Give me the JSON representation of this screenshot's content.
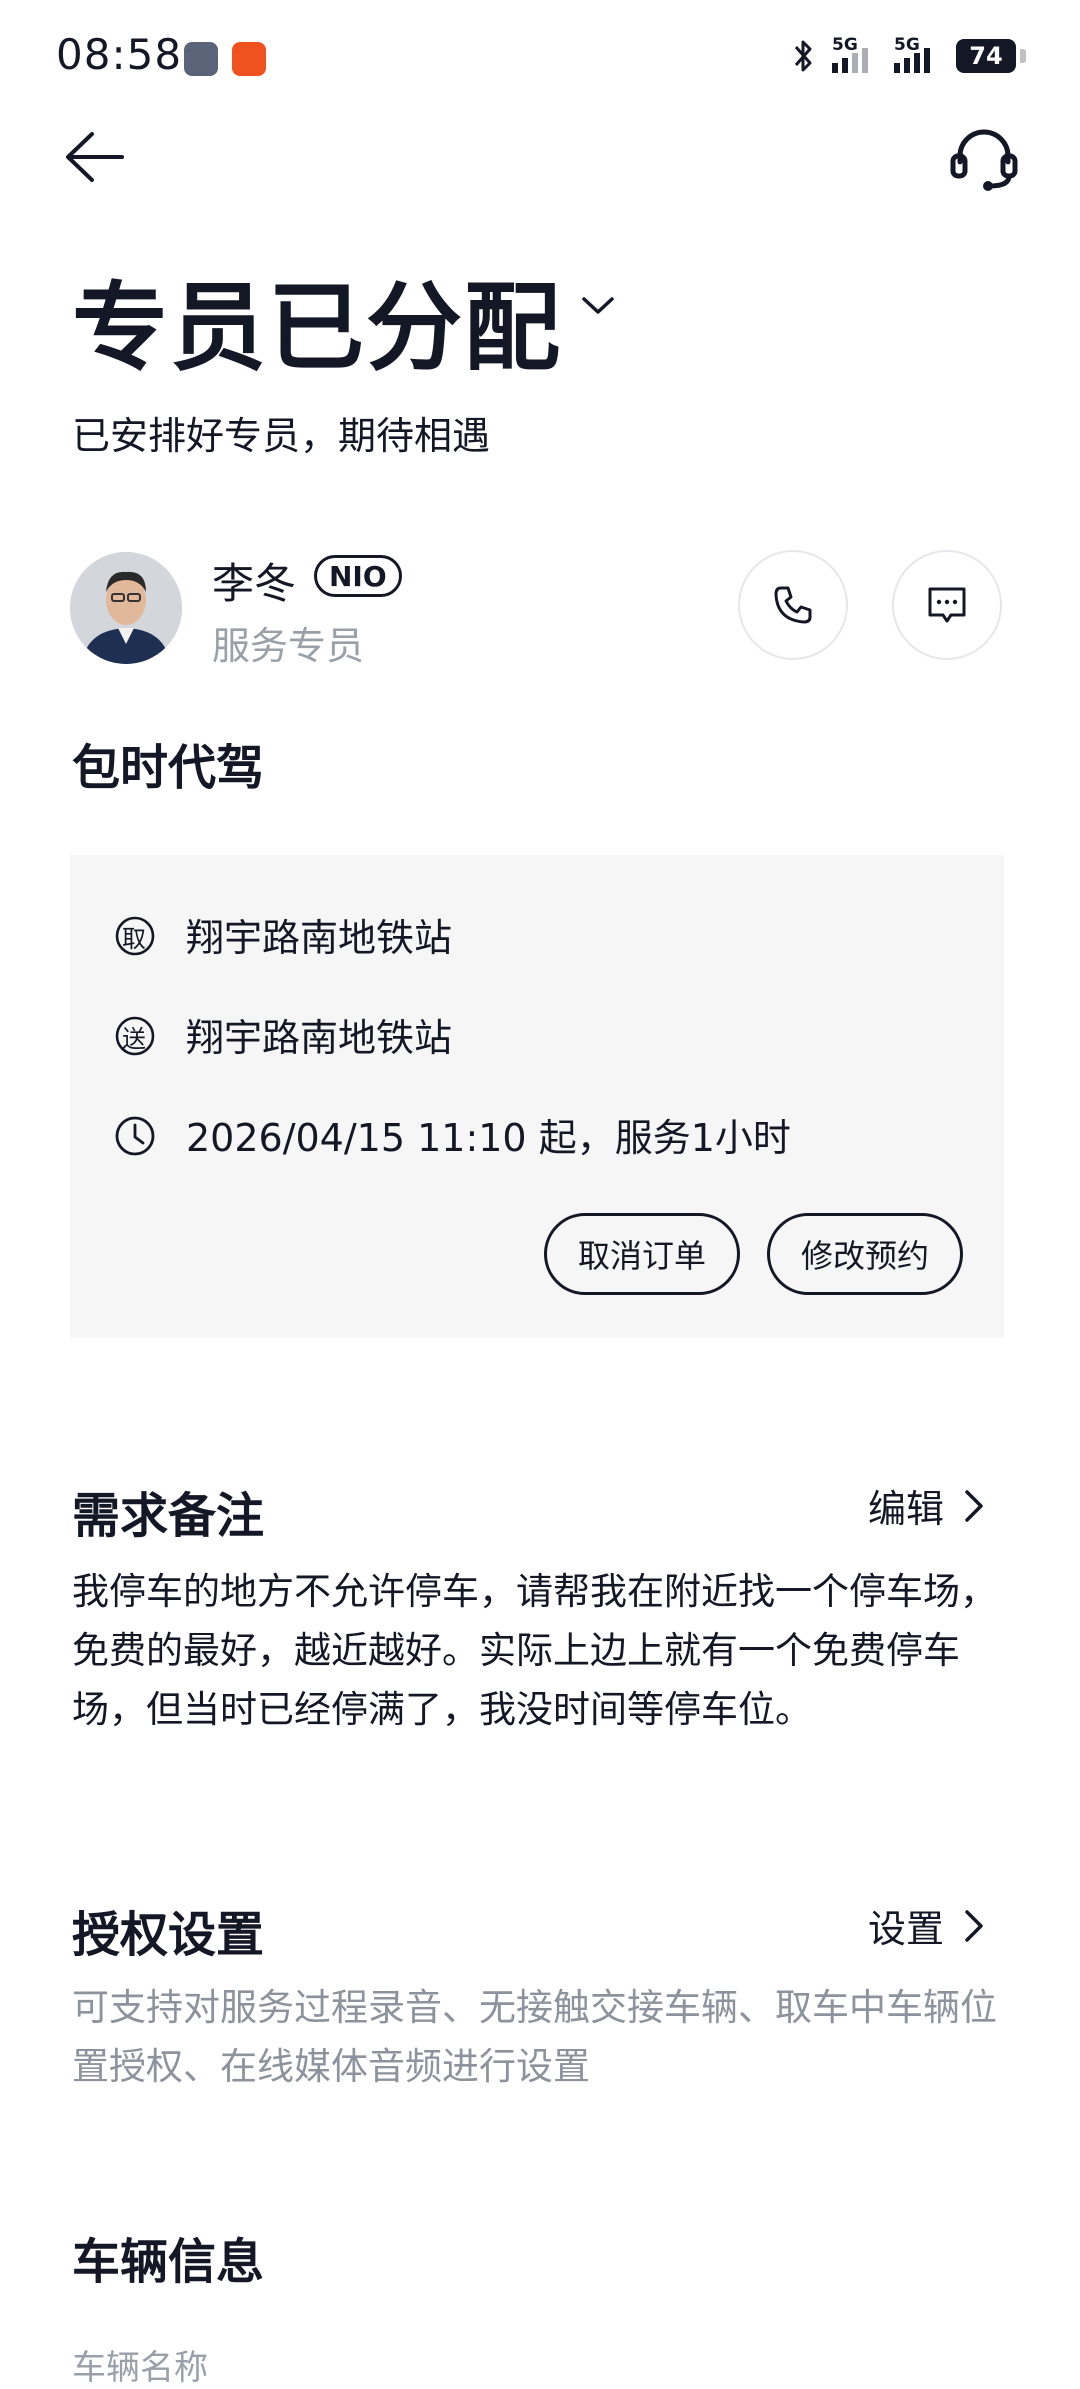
{
  "status_bar": {
    "time": "08:58",
    "signal1_label": "5G",
    "signal2_label": "5G",
    "battery": "74"
  },
  "header": {
    "back_icon": "arrow-left-icon",
    "support_icon": "headset-icon"
  },
  "page": {
    "title": "专员已分配",
    "subtitle": "已安排好专员，期待相遇"
  },
  "agent": {
    "name": "李冬",
    "badge": "NIO",
    "role": "服务专员",
    "call_icon": "phone-icon",
    "message_icon": "message-icon"
  },
  "service": {
    "title": "包时代驾",
    "pickup_icon_text": "取",
    "pickup": "翔宇路南地铁站",
    "dropoff_icon_text": "送",
    "dropoff": "翔宇路南地铁站",
    "time": "2026/04/15 11:10 起，服务1小时",
    "cancel_label": "取消订单",
    "modify_label": "修改预约"
  },
  "notes": {
    "title": "需求备注",
    "edit_label": "编辑",
    "text": "我停车的地方不允许停车，请帮我在附近找一个停车场，免费的最好，越近越好。实际上边上就有一个免费停车场，但当时已经停满了，我没时间等停车位。"
  },
  "auth": {
    "title": "授权设置",
    "settings_label": "设置",
    "text": "可支持对服务过程录音、无接触交接车辆、取车中车辆位置授权、在线媒体音频进行设置"
  },
  "vehicle": {
    "title": "车辆信息",
    "sub": "车辆名称"
  },
  "colors": {
    "text": "#141826",
    "muted": "#8d939c",
    "card_bg": "#f6f6f6"
  }
}
